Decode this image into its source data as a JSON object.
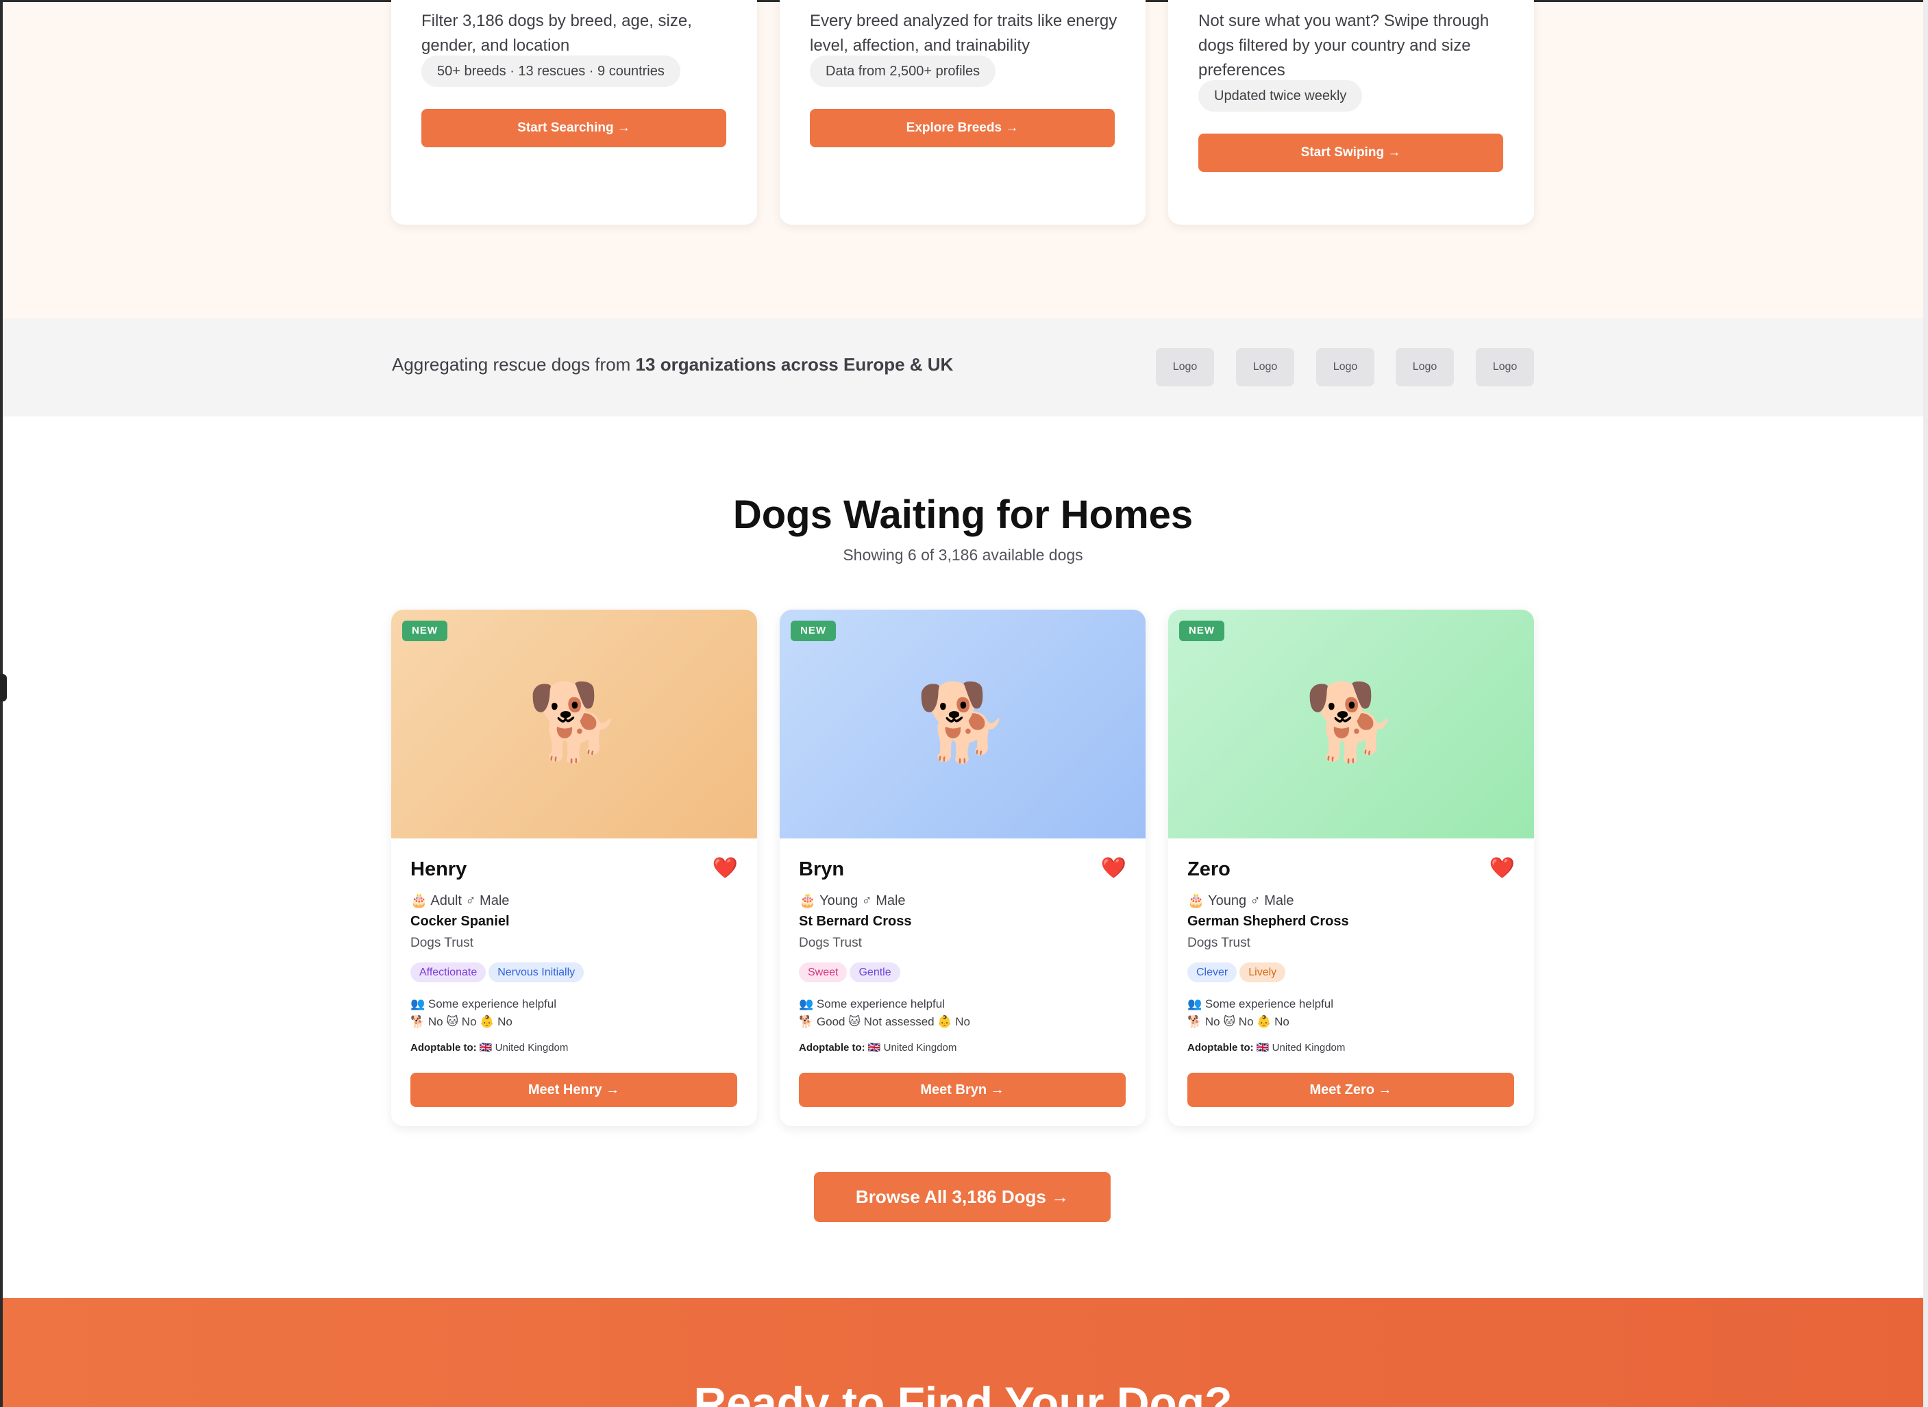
{
  "features": [
    {
      "desc": "Filter 3,186 dogs by breed, age, size, gender, and location",
      "pill": "50+ breeds · 13 rescues · 9 countries",
      "button": "Start Searching →"
    },
    {
      "desc": "Every breed analyzed for traits like energy level, affection, and trainability",
      "pill": "Data from 2,500+ profiles",
      "button": "Explore Breeds →"
    },
    {
      "desc": "Not sure what you want? Swipe through dogs filtered by your country and size preferences",
      "pill": "Updated twice weekly",
      "button": "Start Swiping →"
    }
  ],
  "partners": {
    "prefix": "Aggregating rescue dogs from ",
    "highlight": "13 organizations across Europe & UK",
    "logos": [
      "Logo",
      "Logo",
      "Logo",
      "Logo",
      "Logo"
    ]
  },
  "dogs_section": {
    "title": "Dogs Waiting for Homes",
    "subtitle": "Showing 6 of 3,186 available dogs"
  },
  "dogs": [
    {
      "badge": "NEW",
      "image_icon": "dog",
      "name": "Henry",
      "favorite_icon": "heart",
      "meta": "🎂 Adult ♂ Male",
      "breed": "Cocker Spaniel",
      "organization": "Dogs Trust",
      "tags": [
        "Affectionate",
        "Nervous Initially"
      ],
      "experience": "👥 Some experience helpful",
      "compatibility": "🐕 No 🐱 No 👶 No",
      "adopt_label": "Adoptable to:",
      "adopt_value": " 🇬🇧 United Kingdom",
      "button": "Meet Henry →"
    },
    {
      "badge": "NEW",
      "image_icon": "dog",
      "name": "Bryn",
      "favorite_icon": "heart",
      "meta": "🎂 Young ♂ Male",
      "breed": "St Bernard Cross",
      "organization": "Dogs Trust",
      "tags": [
        "Sweet",
        "Gentle"
      ],
      "experience": "👥 Some experience helpful",
      "compatibility": "🐕 Good 🐱 Not assessed 👶 No",
      "adopt_label": "Adoptable to:",
      "adopt_value": " 🇬🇧 United Kingdom",
      "button": "Meet Bryn →"
    },
    {
      "badge": "NEW",
      "image_icon": "dog",
      "name": "Zero",
      "favorite_icon": "heart",
      "meta": "🎂 Young ♂ Male",
      "breed": "German Shepherd Cross",
      "organization": "Dogs Trust",
      "tags": [
        "Clever",
        "Lively"
      ],
      "experience": "👥 Some experience helpful",
      "compatibility": "🐕 No 🐱 No 👶 No",
      "adopt_label": "Adoptable to:",
      "adopt_value": " 🇬🇧 United Kingdom",
      "button": "Meet Zero →"
    }
  ],
  "browse_button": "Browse All 3,186 Dogs →",
  "ready": {
    "title": "Ready to Find Your Dog?"
  },
  "colors": {
    "accent": "#ee7443",
    "new_badge": "#3ea86c",
    "cream_bg": "#fff8f2"
  }
}
